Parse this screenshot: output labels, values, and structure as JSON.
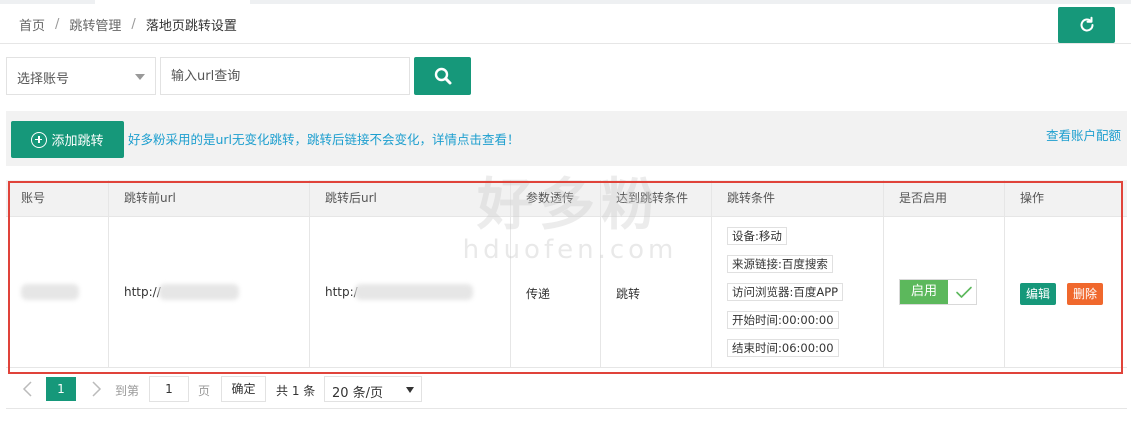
{
  "breadcrumb": {
    "home": "首页",
    "separator": "/",
    "section": "跳转管理",
    "current": "落地页跳转设置"
  },
  "toolbar": {
    "refresh_icon": "refresh-icon"
  },
  "search": {
    "account_select": "选择账号",
    "url_placeholder": "输入url查询",
    "search_icon": "search-icon"
  },
  "actions": {
    "add_label": "添加跳转",
    "notice": "好多粉采用的是url无变化跳转，跳转后链接不会变化，详情点击查看！",
    "quota_link": "查看账户配额"
  },
  "table": {
    "columns": [
      "账号",
      "跳转前url",
      "跳转后url",
      "参数透传",
      "达到跳转条件",
      "跳转条件",
      "是否启用",
      "操作"
    ],
    "rows": [
      {
        "account": "",
        "before_url": "http://",
        "after_url": "http:/",
        "param_pass": "传递",
        "trigger": "跳转",
        "conditions": [
          "设备:移动",
          "来源链接:百度搜索",
          "访问浏览器:百度APP",
          "开始时间:00:00:00",
          "结束时间:06:00:00"
        ],
        "enabled_label": "启用",
        "edit_label": "编辑",
        "delete_label": "删除"
      }
    ]
  },
  "pager": {
    "current_page": "1",
    "goto_label": "到第",
    "goto_value": "1",
    "page_label": "页",
    "confirm_label": "确定",
    "total": "共 1 条",
    "page_size": "20 条/页"
  },
  "watermark": {
    "brand_cn": "好多粉",
    "brand_en": "hduofen.com"
  },
  "colors": {
    "primary": "#16987a",
    "link": "#1e9fcf",
    "danger": "#f0682d",
    "success": "#5cb85c",
    "highlight": "#e0433a"
  }
}
